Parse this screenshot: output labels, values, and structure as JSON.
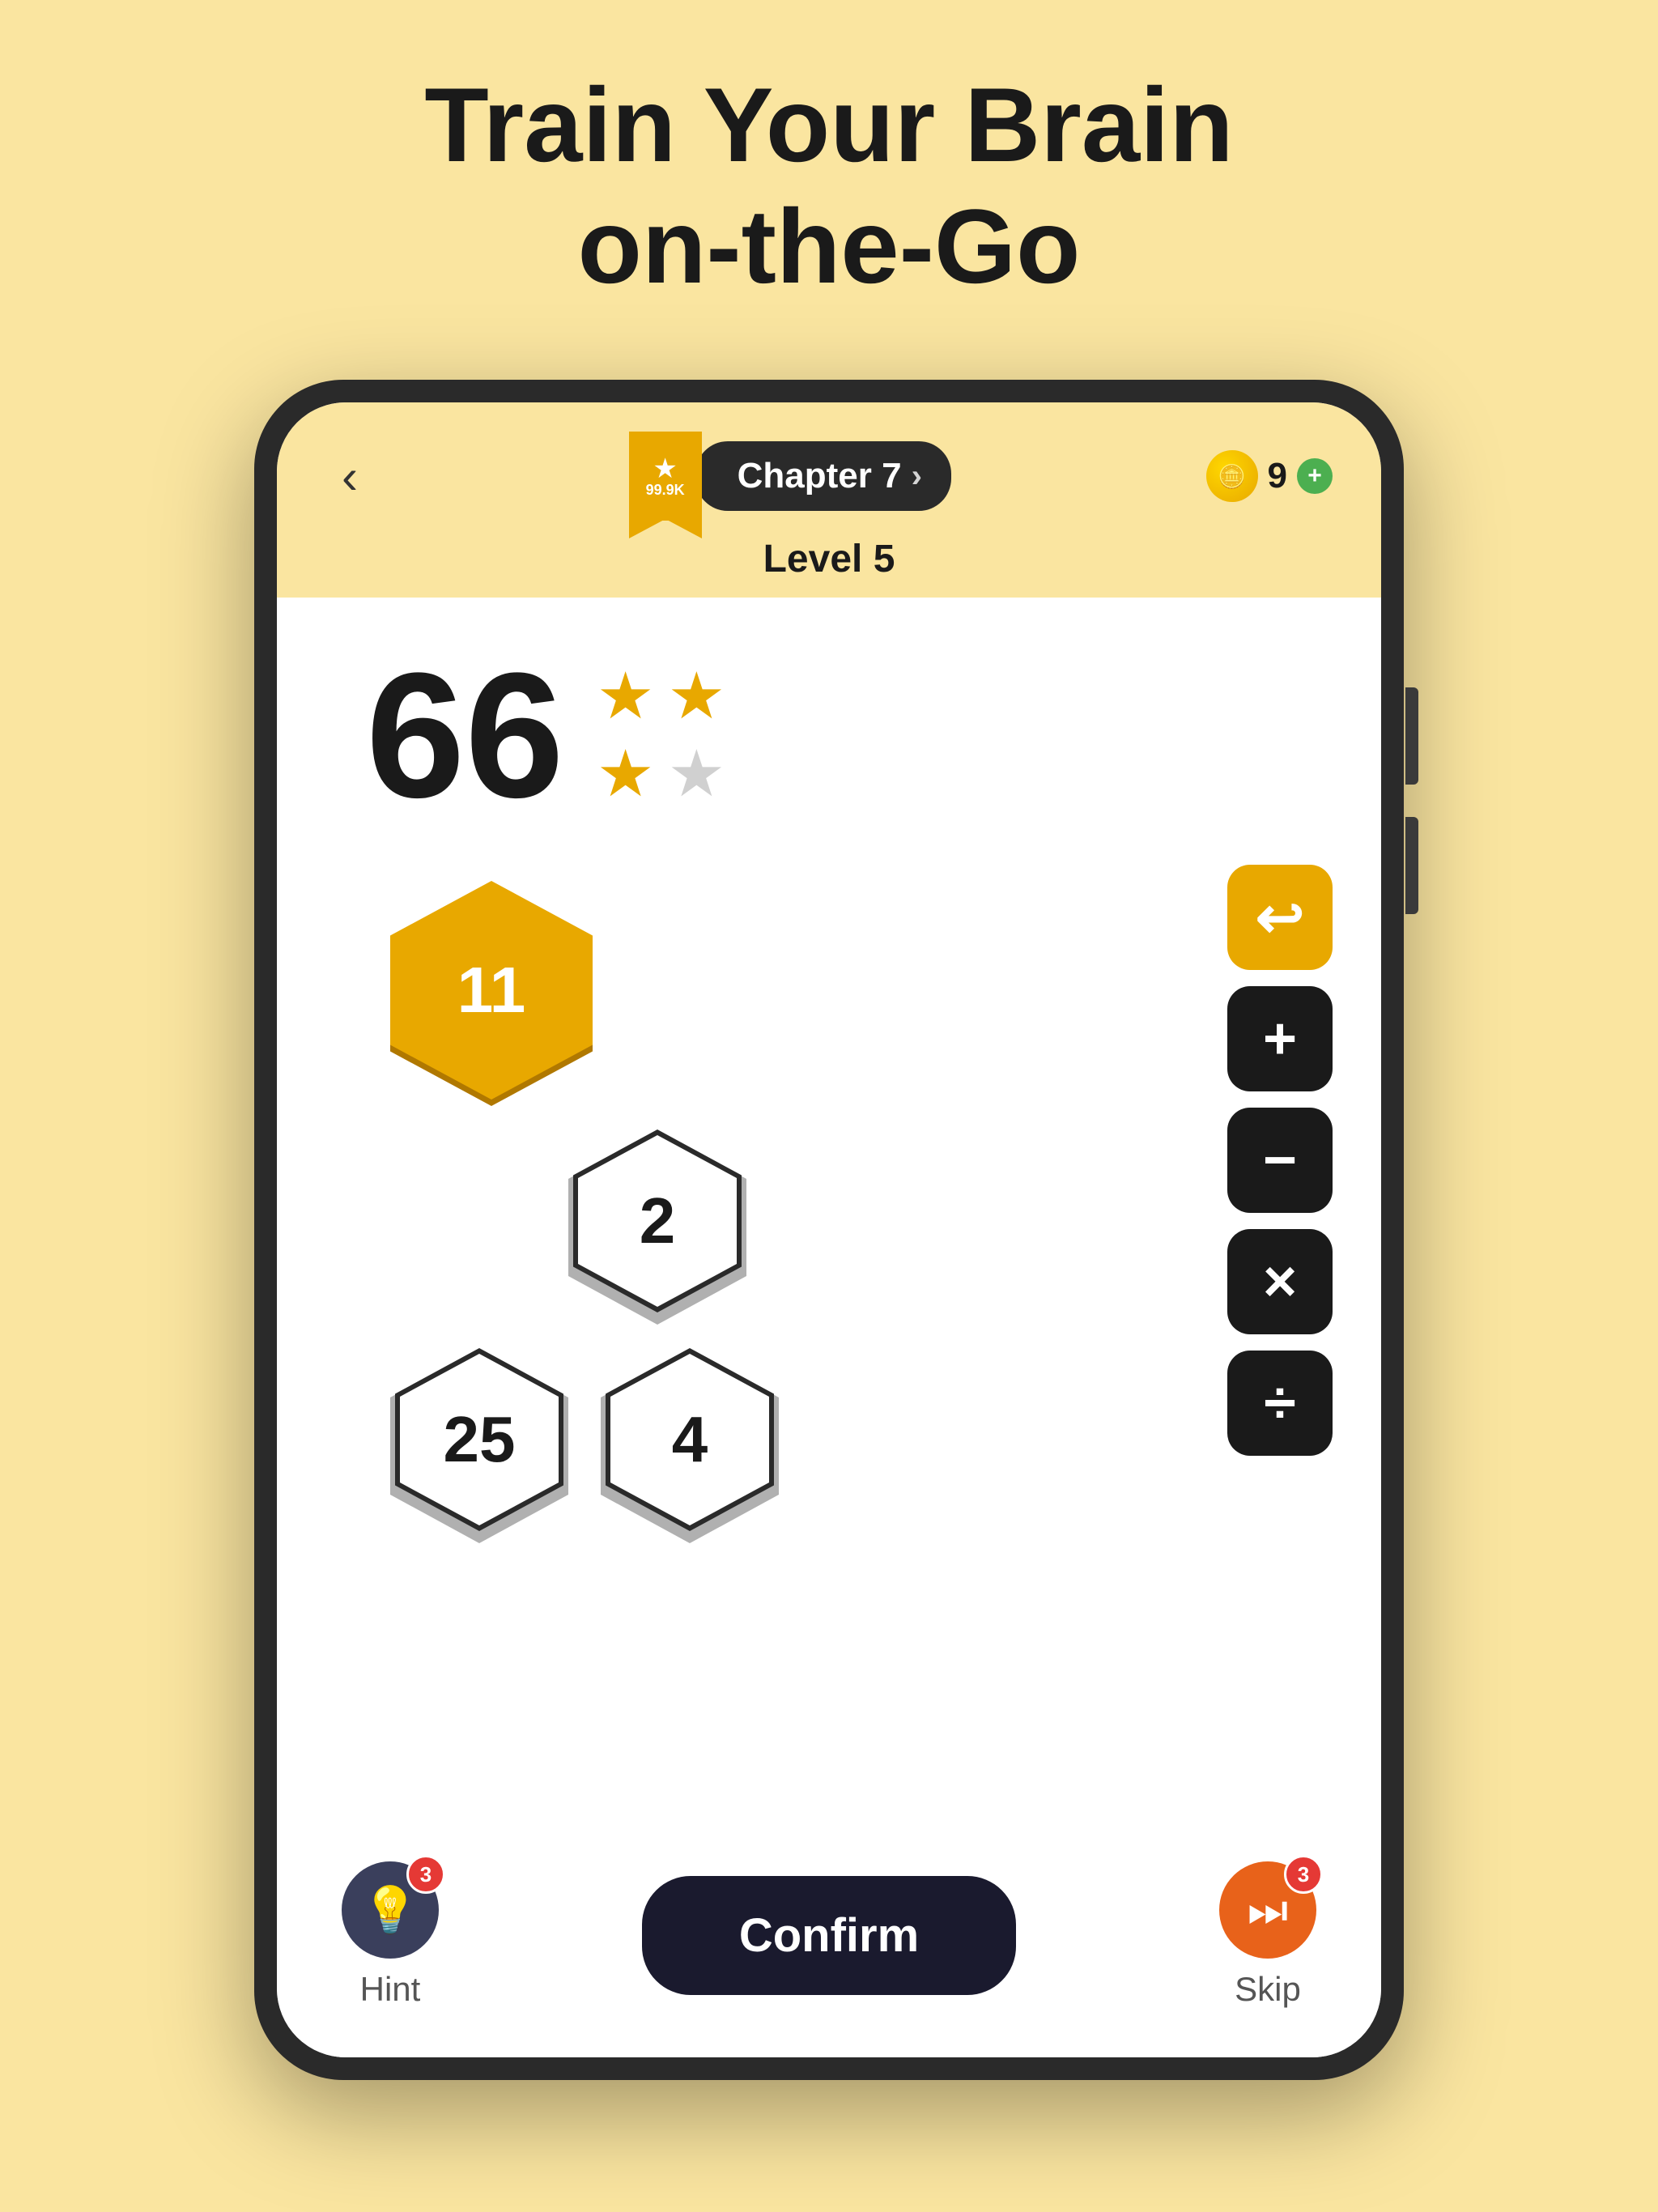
{
  "page": {
    "background_color": "#FAE5A0",
    "title": "Train Your Brain\non-the-Go"
  },
  "header": {
    "back_label": "‹",
    "star_count": "99.9K",
    "chapter_label": "Chapter 7",
    "chapter_chevron": "›",
    "coin_count": "9",
    "add_coin_label": "+",
    "level_label": "Level 5"
  },
  "game": {
    "score": "66",
    "stars": [
      {
        "filled": true
      },
      {
        "filled": true
      },
      {
        "filled": true
      },
      {
        "filled": false
      }
    ],
    "hexagons": [
      {
        "value": "11",
        "type": "filled",
        "row": 1
      },
      {
        "value": "2",
        "type": "outline",
        "row": 2
      },
      {
        "value": "25",
        "type": "outline",
        "row": 3
      },
      {
        "value": "4",
        "type": "outline",
        "row": 3
      }
    ],
    "operators": [
      {
        "symbol": "↩",
        "type": "undo"
      },
      {
        "symbol": "+",
        "type": "add"
      },
      {
        "symbol": "−",
        "type": "sub"
      },
      {
        "symbol": "×",
        "type": "mul"
      },
      {
        "symbol": "÷",
        "type": "div"
      }
    ]
  },
  "bottom": {
    "hint_label": "Hint",
    "hint_badge": "3",
    "confirm_label": "Confirm",
    "skip_label": "Skip",
    "skip_badge": "3"
  }
}
